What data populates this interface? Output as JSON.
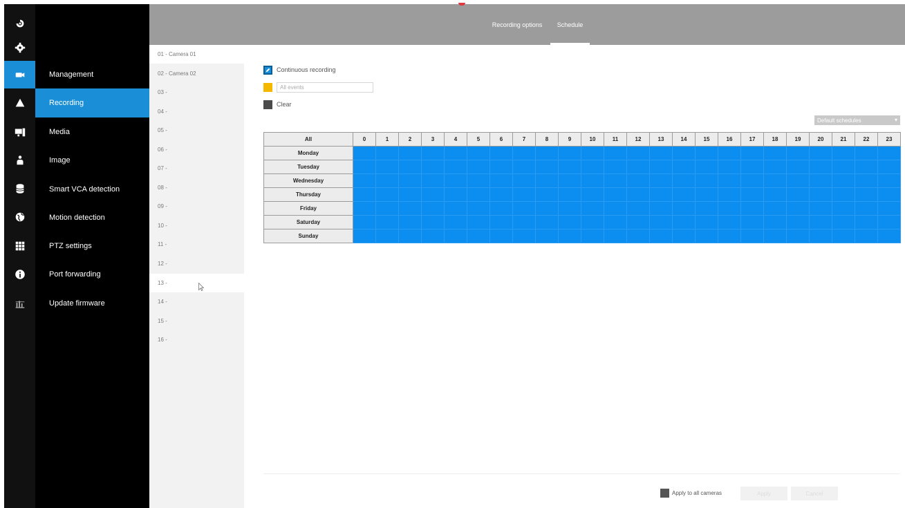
{
  "colors": {
    "accent": "#1a8fd8",
    "schedule_fill": "#0b8ef0",
    "event_swatch": "#f5b800",
    "clear_swatch": "#4a4a4a",
    "topbar": "#9c9c9c"
  },
  "rail_icons": [
    "status-icon",
    "gear-icon",
    "camera-icon",
    "alert-icon",
    "monitor-icon",
    "user-icon",
    "storage-icon",
    "globe-icon",
    "grid-icon",
    "info-icon",
    "chart-icon"
  ],
  "nav": {
    "items": [
      {
        "label": "Management"
      },
      {
        "label": "Recording"
      },
      {
        "label": "Media"
      },
      {
        "label": "Image"
      },
      {
        "label": "Smart VCA detection"
      },
      {
        "label": "Motion detection"
      },
      {
        "label": "PTZ settings"
      },
      {
        "label": "Port forwarding"
      },
      {
        "label": "Update firmware"
      }
    ]
  },
  "tabs": [
    {
      "label": "Recording options"
    },
    {
      "label": "Schedule"
    }
  ],
  "cameras": [
    "01 - Camera 01",
    "02 - Camera 02",
    "03 -",
    "04 -",
    "05 -",
    "06 -",
    "07 -",
    "08 -",
    "09 -",
    "10 -",
    "11 -",
    "12 -",
    "13 -",
    "14 -",
    "15 -",
    "16 -"
  ],
  "legend": {
    "continuous": "Continuous recording",
    "events_placeholder": "All events",
    "clear": "Clear"
  },
  "schedule": {
    "preset": "Default schedules",
    "all_label": "All",
    "hours": [
      "0",
      "1",
      "2",
      "3",
      "4",
      "5",
      "6",
      "7",
      "8",
      "9",
      "10",
      "11",
      "12",
      "13",
      "14",
      "15",
      "16",
      "17",
      "18",
      "19",
      "20",
      "21",
      "22",
      "23"
    ],
    "days": [
      "Monday",
      "Tuesday",
      "Wednesday",
      "Thursday",
      "Friday",
      "Saturday",
      "Sunday"
    ]
  },
  "footer": {
    "apply_all": "Apply to all cameras",
    "apply": "Apply",
    "cancel": "Cancel"
  }
}
